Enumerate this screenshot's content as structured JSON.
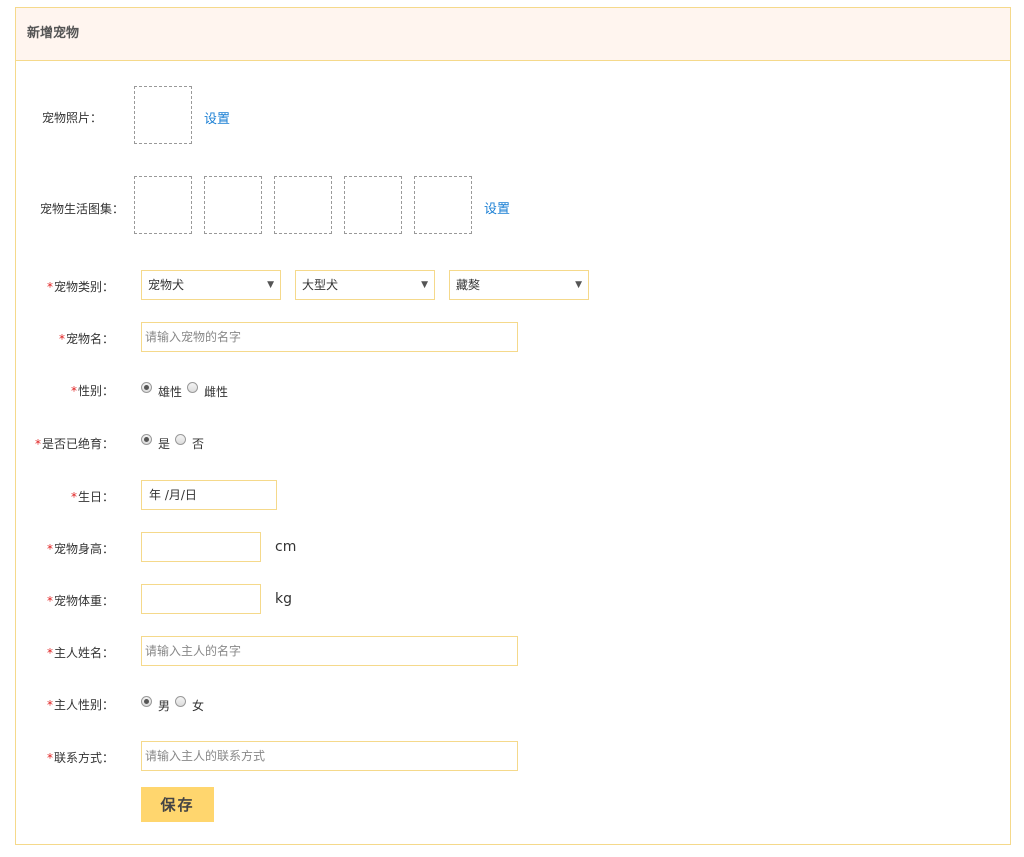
{
  "panel": {
    "title": "新增宠物"
  },
  "fields": {
    "photo": {
      "label": "宠物照片：",
      "action": "设置"
    },
    "gallery": {
      "label": "宠物生活图集：",
      "action": "设置"
    },
    "category": {
      "required": "*",
      "label": "宠物类别：",
      "selects": [
        "宠物犬",
        "大型犬",
        "藏獒"
      ]
    },
    "name": {
      "required": "*",
      "label": "宠物名：",
      "placeholder": "请输入宠物的名字"
    },
    "gender": {
      "required": "*",
      "label": "性别：",
      "options": [
        "雄性",
        "雌性"
      ],
      "selected": "雄性"
    },
    "neutered": {
      "required": "*",
      "label": "是否已绝育：",
      "options": [
        "是",
        "否"
      ],
      "selected": "是"
    },
    "birthday": {
      "required": "*",
      "label": "生日：",
      "value": "年 /月/日"
    },
    "height": {
      "required": "*",
      "label": "宠物身高：",
      "unit": "cm"
    },
    "weight": {
      "required": "*",
      "label": "宠物体重：",
      "unit": "kg"
    },
    "owner_name": {
      "required": "*",
      "label": "主人姓名：",
      "placeholder": "请输入主人的名字"
    },
    "owner_gender": {
      "required": "*",
      "label": "主人性别：",
      "options": [
        "男",
        "女"
      ],
      "selected": "男"
    },
    "contact": {
      "required": "*",
      "label": "联系方式：",
      "placeholder": "请输入主人的联系方式"
    }
  },
  "actions": {
    "save": "保存"
  },
  "colors": {
    "border": "#f5d98b",
    "header_bg": "#fff5ef",
    "button_bg": "#ffd66e",
    "link": "#1a7fd4",
    "required": "#e02020"
  }
}
